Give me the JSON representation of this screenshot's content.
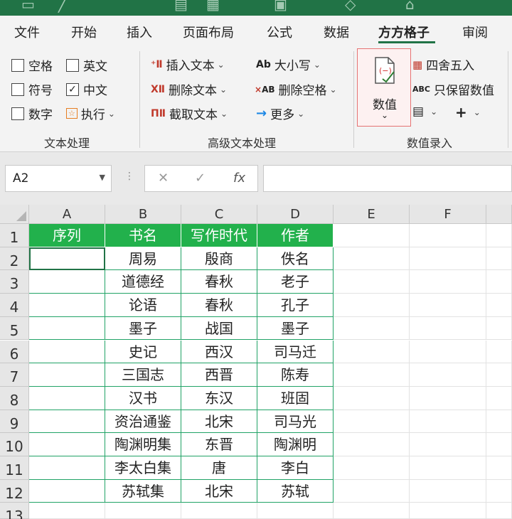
{
  "ribbon_tabs": [
    {
      "label": "文件"
    },
    {
      "label": "开始"
    },
    {
      "label": "插入"
    },
    {
      "label": "页面布局"
    },
    {
      "label": "公式"
    },
    {
      "label": "数据"
    },
    {
      "label": "方方格子",
      "active": true
    },
    {
      "label": "审阅"
    }
  ],
  "text_group": {
    "label": "文本处理",
    "checks": [
      {
        "label": "空格",
        "checked": false
      },
      {
        "label": "英文",
        "checked": false
      },
      {
        "label": "符号",
        "checked": false
      },
      {
        "label": "中文",
        "checked": true
      },
      {
        "label": "数字",
        "checked": false
      }
    ],
    "execute_label": "执行"
  },
  "adv_group": {
    "label": "高级文本处理",
    "insert_text": "插入文本",
    "delete_text": "删除文本",
    "extract_text": "截取文本",
    "case": "大小写",
    "delete_space": "删除空格",
    "more": "更多"
  },
  "value_group": {
    "label": "数值录入",
    "value_button": "数值",
    "round": "四舍五入",
    "keep_value": "只保留数值"
  },
  "name_box": "A2",
  "grid": {
    "columns": [
      "A",
      "B",
      "C",
      "D",
      "E",
      "F"
    ],
    "rows": [
      "1",
      "2",
      "3",
      "4",
      "5",
      "6",
      "7",
      "8",
      "9",
      "10",
      "11",
      "12",
      "13"
    ],
    "header": [
      "序列",
      "书名",
      "写作时代",
      "作者"
    ],
    "data": [
      [
        "",
        "周易",
        "殷商",
        "佚名"
      ],
      [
        "",
        "道德经",
        "春秋",
        "老子"
      ],
      [
        "",
        "论语",
        "春秋",
        "孔子"
      ],
      [
        "",
        "墨子",
        "战国",
        "墨子"
      ],
      [
        "",
        "史记",
        "西汉",
        "司马迁"
      ],
      [
        "",
        "三国志",
        "西晋",
        "陈寿"
      ],
      [
        "",
        "汉书",
        "东汉",
        "班固"
      ],
      [
        "",
        "资治通鉴",
        "北宋",
        "司马光"
      ],
      [
        "",
        "陶渊明集",
        "东晋",
        "陶渊明"
      ],
      [
        "",
        "李太白集",
        "唐",
        "李白"
      ],
      [
        "",
        "苏轼集",
        "北宋",
        "苏轼"
      ]
    ]
  },
  "colors": {
    "accent": "#217346",
    "table_header": "#22b14c",
    "table_border": "#21a366"
  }
}
